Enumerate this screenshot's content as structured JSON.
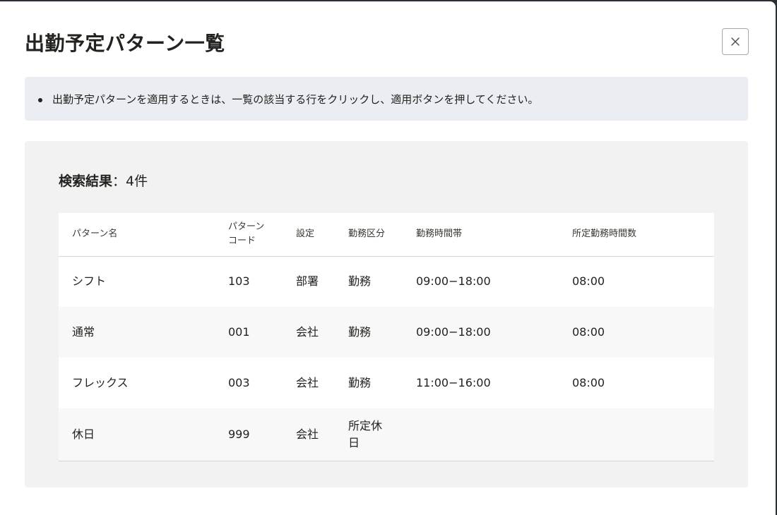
{
  "dialog": {
    "title": "出勤予定パターン一覧",
    "close_label": "×"
  },
  "info": {
    "items": [
      "出勤予定パターンを適用するときは、一覧の該当する行をクリックし、適用ボタンを押してください。"
    ]
  },
  "results": {
    "count_label": "検索結果",
    "count_value": "：4件",
    "columns": [
      "パターン名",
      "パターンコード",
      "設定",
      "勤務区分",
      "勤務時間帯",
      "所定勤務時間数"
    ],
    "rows": [
      {
        "name": "シフト",
        "code": "103",
        "setting": "部署",
        "type": "勤務",
        "time": "09:00−18:00",
        "hours": "08:00"
      },
      {
        "name": "通常",
        "code": "001",
        "setting": "会社",
        "type": "勤務",
        "time": "09:00−18:00",
        "hours": "08:00"
      },
      {
        "name": "フレックス",
        "code": "003",
        "setting": "会社",
        "type": "勤務",
        "time": "11:00−16:00",
        "hours": "08:00"
      },
      {
        "name": "休日",
        "code": "999",
        "setting": "会社",
        "type": "所定休日",
        "time": "",
        "hours": ""
      }
    ]
  },
  "colors": {
    "text": "#23221e",
    "info_background": "#eaedf2",
    "panel_background": "#f2f2f2",
    "row_stripe": "#f8f8f8",
    "border": "#d6d3d0"
  }
}
